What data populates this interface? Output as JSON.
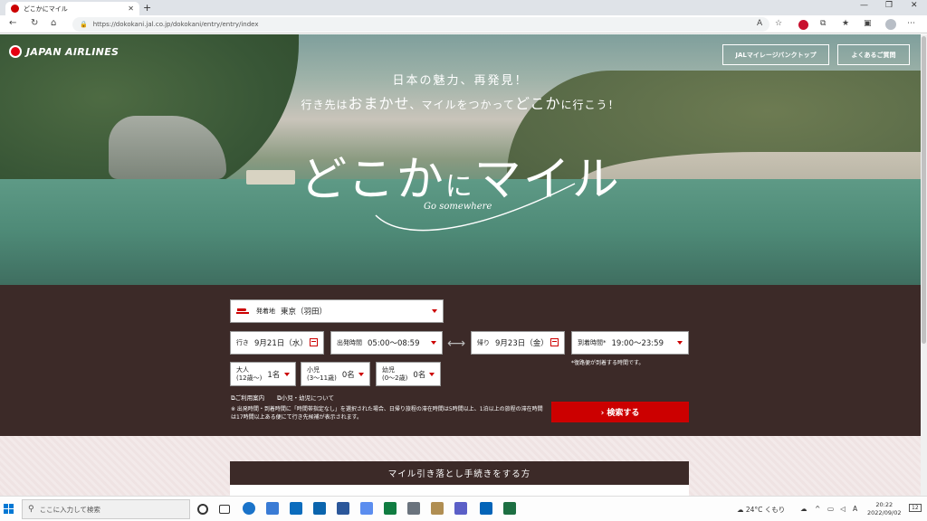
{
  "browser": {
    "tab_title": "どこかにマイル",
    "url": "https://dokokani.jal.co.jp/dokokani/entry/entry/index"
  },
  "header": {
    "logo_text": "JAPAN AIRLINES",
    "btn_mileage": "JALマイレージバンクトップ",
    "btn_faq": "よくあるご質問"
  },
  "hero": {
    "line1": "日本の魅力、再発見！",
    "line2_a": "行き先は",
    "line2_b": "おまかせ",
    "line2_c": "、マイルをつかって",
    "line2_d": "どこか",
    "line2_e": "に行こう！",
    "title_a": "どこか",
    "title_b": "に",
    "title_c": "マイル",
    "subtitle": "Go somewhere"
  },
  "search": {
    "origin_label": "発着地",
    "origin_value": "東京（羽田）",
    "out_label": "行き",
    "out_date": "9月21日（水）",
    "dep_time_label": "出発時間",
    "dep_time_value": "05:00〜08:59",
    "ret_label": "帰り",
    "ret_date": "9月23日（金）",
    "arr_time_label": "到着時間*",
    "arr_time_value": "19:00〜23:59",
    "arr_note": "*復路便が到着する時間です。",
    "adult_label": "大人",
    "adult_sub": "(12歳〜)",
    "adult_value": "1名",
    "child_label": "小児",
    "child_sub": "(3〜11歳)",
    "child_value": "0名",
    "infant_label": "幼児",
    "infant_sub": "(0〜2歳)",
    "infant_value": "0名",
    "link_guide": "ご利用案内",
    "link_children": "小児・幼児について",
    "notice": "※ 出発時間・到着時間に「時間帯指定なし」を選択された場合、日帰り旅程の滞在時間は5時間以上、1泊以上の旅程の滞在時間は17時間以上ある便にて行き先候補が表示されます。",
    "search_button": "› 検索する"
  },
  "lower": {
    "section_title": "マイル引き落とし手続きをする方"
  },
  "taskbar": {
    "search_placeholder": "ここに入力して検索",
    "weather": "24°C くもり",
    "time": "20:22",
    "date": "2022/09/02",
    "notif_count": "12"
  }
}
